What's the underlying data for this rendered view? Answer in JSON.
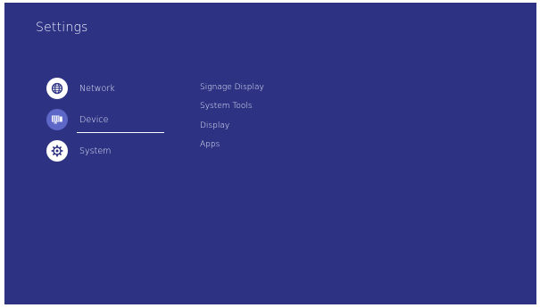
{
  "page": {
    "title": "Settings"
  },
  "nav": {
    "items": [
      {
        "label": "Network",
        "icon": "globe-icon",
        "selected": false
      },
      {
        "label": "Device",
        "icon": "device-icon",
        "selected": true
      },
      {
        "label": "System",
        "icon": "gear-icon",
        "selected": false
      }
    ]
  },
  "submenu": {
    "items": [
      {
        "label": "Signage Display"
      },
      {
        "label": "System Tools"
      },
      {
        "label": "Display"
      },
      {
        "label": "Apps"
      }
    ]
  },
  "colors": {
    "background": "#2d3382",
    "selected_circle": "#5c67c8",
    "icon_dark": "#2d3382",
    "text": "#e9ebff"
  }
}
